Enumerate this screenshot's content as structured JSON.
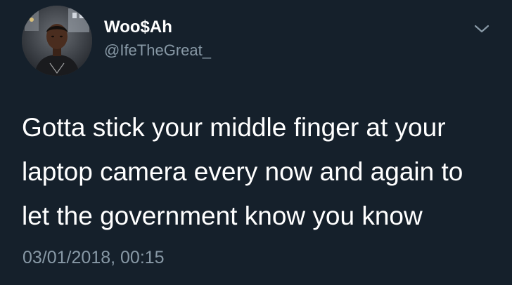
{
  "author": {
    "display_name": "Woo$Ah",
    "handle": "@IfeTheGreat_",
    "avatar_icon": "profile-photo"
  },
  "menu": {
    "icon": "chevron-down-icon"
  },
  "tweet": {
    "lines": [
      "Gotta stick your middle finger at your",
      "laptop camera every now and again to",
      "let the government know you know"
    ],
    "timestamp": "03/01/2018, 00:15"
  },
  "colors": {
    "background": "#15202b",
    "primary_text": "#ffffff",
    "secondary_text": "#8899a6"
  }
}
